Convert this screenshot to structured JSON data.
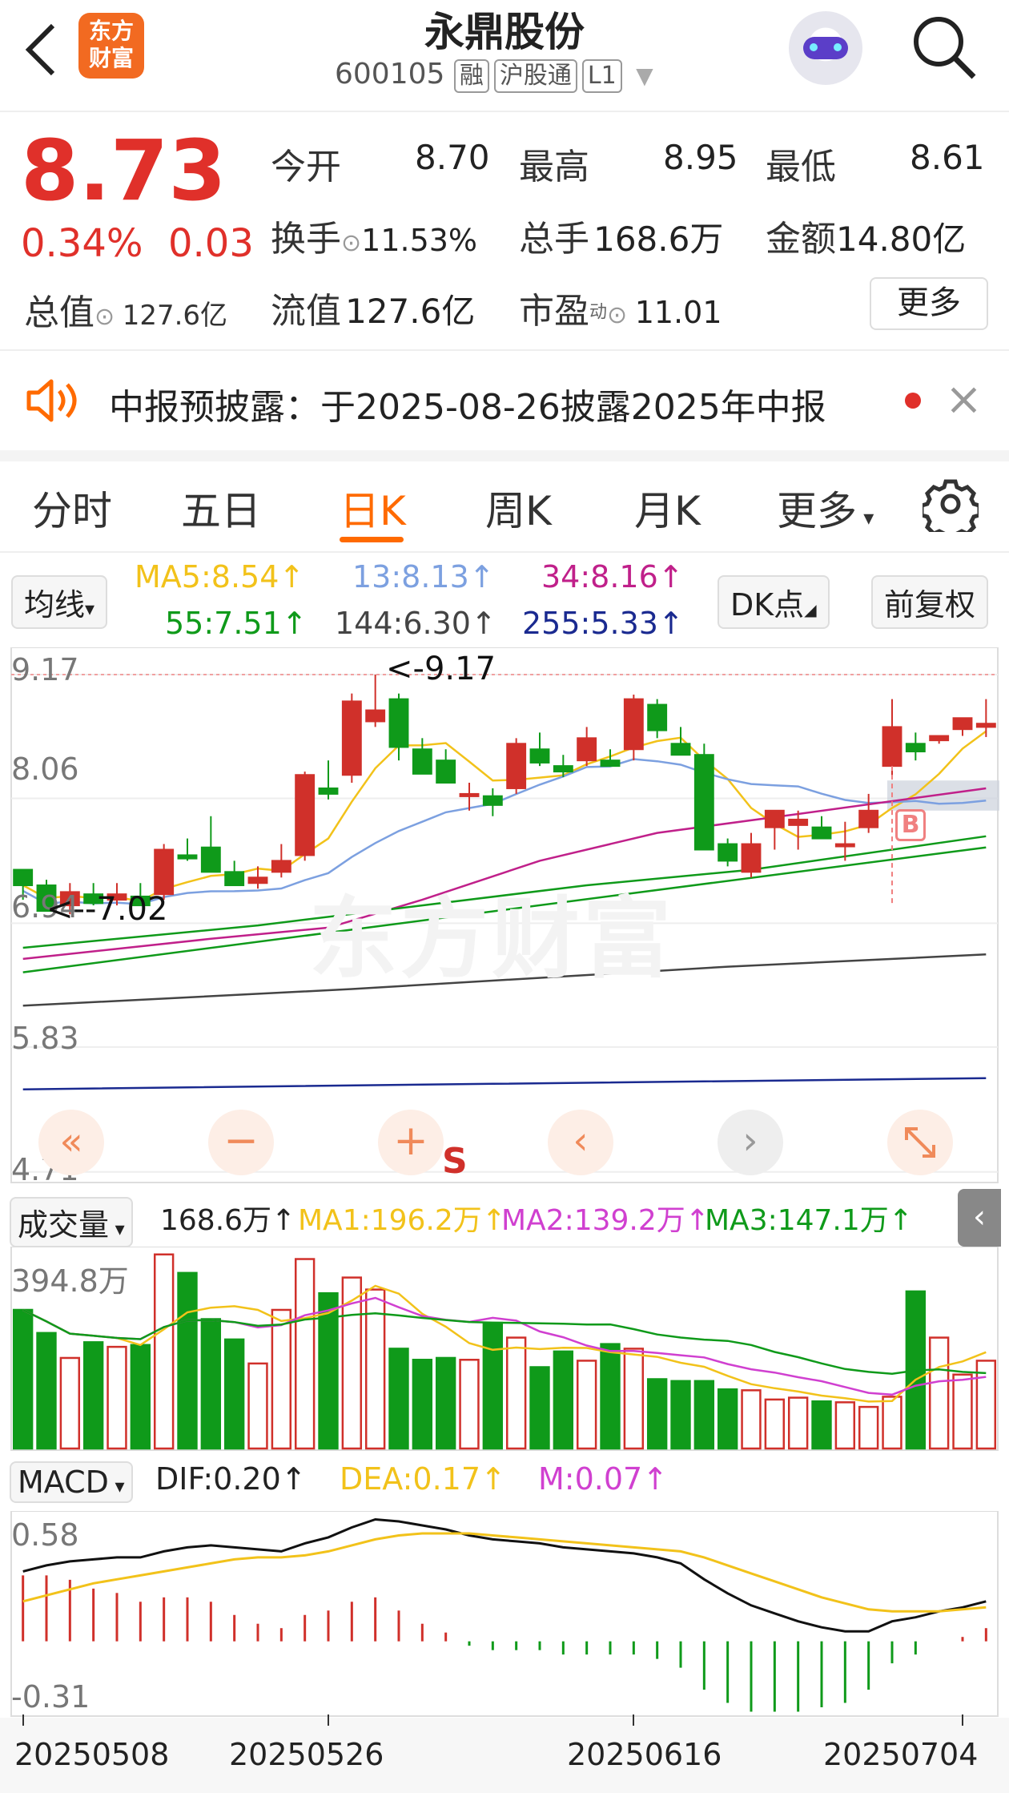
{
  "header": {
    "back_icon": "back-arrow-icon",
    "logo_text": "东方\n财富",
    "title": "永鼎股份",
    "code": "600105",
    "tags": [
      "融",
      "沪股通",
      "L1"
    ],
    "search_icon": "search-icon",
    "avatar_icon": "robot-avatar-icon"
  },
  "quote": {
    "price": "8.73",
    "change_pct": "0.34%",
    "change": "0.03",
    "rows": [
      [
        {
          "label": "今开",
          "value": "8.70",
          "color": "dark"
        },
        {
          "label": "最高",
          "value": "8.95",
          "color": "red"
        },
        {
          "label": "最低",
          "value": "8.61",
          "color": "green"
        }
      ],
      [
        {
          "label": "换手",
          "value": "11.53%"
        },
        {
          "label": "总手",
          "value": "168.6万"
        },
        {
          "label": "金额",
          "value": "14.80亿"
        }
      ],
      [
        {
          "label": "流值",
          "value": "127.6亿"
        },
        {
          "label": "市盈",
          "sup": "动",
          "value": "11.01"
        }
      ]
    ],
    "total_label": "总值",
    "total_value": "127.6亿",
    "more": "更多"
  },
  "notice": {
    "text": "中报预披露：于2025-08-26披露2025年中报",
    "close": "×"
  },
  "tabs": [
    "分时",
    "五日",
    "日K",
    "周K",
    "月K",
    "更多"
  ],
  "ma": {
    "button": "均线",
    "ma5": "MA5:8.54↑",
    "ma13": "13:8.13↑",
    "ma34": "34:8.16↑",
    "ma55": "55:7.51↑",
    "ma144": "144:6.30↑",
    "ma255": "255:5.33↑",
    "dk": "DK点",
    "adj": "前复权"
  },
  "price_axis": [
    "9.17",
    "8.06",
    "6.94",
    "5.83",
    "4.71"
  ],
  "annotations": {
    "high": "<-9.17",
    "low": "<--7.02",
    "b": "B",
    "s": "S"
  },
  "volume": {
    "button": "成交量",
    "vol": "168.6万↑",
    "ma1": "MA1:196.2万↑",
    "ma2": "MA2:139.2万↑",
    "ma3": "MA3:147.1万↑",
    "axis_max": "394.8万"
  },
  "macd": {
    "button": "MACD",
    "dif": "DIF:0.20↑",
    "dea": "DEA:0.17↑",
    "m": "M:0.07↑",
    "axis_max": "0.58",
    "axis_min": "-0.31"
  },
  "dates": [
    "20250508",
    "20250526",
    "20250616",
    "20250704"
  ],
  "colors": {
    "up": "#d0302a",
    "down": "#0f9a1a",
    "accent": "#ff6a00"
  },
  "chart_data": {
    "type": "candlestick",
    "ohlc": [
      [
        7.42,
        7.35,
        7.15,
        7.28
      ],
      [
        7.28,
        7.33,
        7.07,
        7.05
      ],
      [
        7.1,
        7.3,
        7.02,
        7.22
      ],
      [
        7.2,
        7.3,
        7.1,
        7.12
      ],
      [
        7.15,
        7.3,
        7.1,
        7.2
      ],
      [
        7.18,
        7.3,
        7.1,
        7.1
      ],
      [
        7.2,
        7.65,
        7.15,
        7.6
      ],
      [
        7.55,
        7.7,
        7.5,
        7.52
      ],
      [
        7.62,
        7.9,
        7.55,
        7.4
      ],
      [
        7.4,
        7.5,
        7.3,
        7.28
      ],
      [
        7.3,
        7.45,
        7.25,
        7.35
      ],
      [
        7.4,
        7.65,
        7.35,
        7.5
      ],
      [
        7.55,
        8.3,
        7.5,
        8.27
      ],
      [
        8.15,
        8.4,
        8.05,
        8.1
      ],
      [
        8.27,
        9.0,
        8.2,
        8.93
      ],
      [
        8.75,
        9.17,
        8.7,
        8.85
      ],
      [
        8.95,
        9.0,
        8.4,
        8.52
      ],
      [
        8.5,
        8.6,
        8.3,
        8.28
      ],
      [
        8.4,
        8.5,
        8.2,
        8.2
      ],
      [
        8.1,
        8.2,
        7.95,
        8.1
      ],
      [
        8.08,
        8.15,
        7.9,
        8.0
      ],
      [
        8.15,
        8.6,
        8.1,
        8.55
      ],
      [
        8.5,
        8.65,
        8.35,
        8.38
      ],
      [
        8.35,
        8.45,
        8.25,
        8.3
      ],
      [
        8.4,
        8.7,
        8.35,
        8.6
      ],
      [
        8.4,
        8.5,
        8.35,
        8.35
      ],
      [
        8.5,
        8.99,
        8.4,
        8.95
      ],
      [
        8.9,
        8.95,
        8.6,
        8.67
      ],
      [
        8.55,
        8.7,
        8.5,
        8.45
      ],
      [
        8.45,
        8.55,
        8.0,
        7.6
      ],
      [
        7.65,
        7.7,
        7.45,
        7.5
      ],
      [
        7.4,
        7.75,
        7.35,
        7.65
      ],
      [
        7.8,
        7.9,
        7.6,
        7.95
      ],
      [
        7.82,
        7.95,
        7.6,
        7.87
      ],
      [
        7.8,
        7.9,
        7.7,
        7.7
      ],
      [
        7.65,
        7.85,
        7.5,
        7.65
      ],
      [
        7.8,
        8.1,
        7.75,
        7.95
      ],
      [
        8.35,
        8.95,
        8.25,
        8.7
      ],
      [
        8.55,
        8.65,
        8.4,
        8.48
      ],
      [
        8.58,
        8.6,
        8.55,
        8.62
      ],
      [
        8.68,
        8.75,
        8.62,
        8.78
      ],
      [
        8.7,
        8.95,
        8.61,
        8.73
      ]
    ]
  }
}
